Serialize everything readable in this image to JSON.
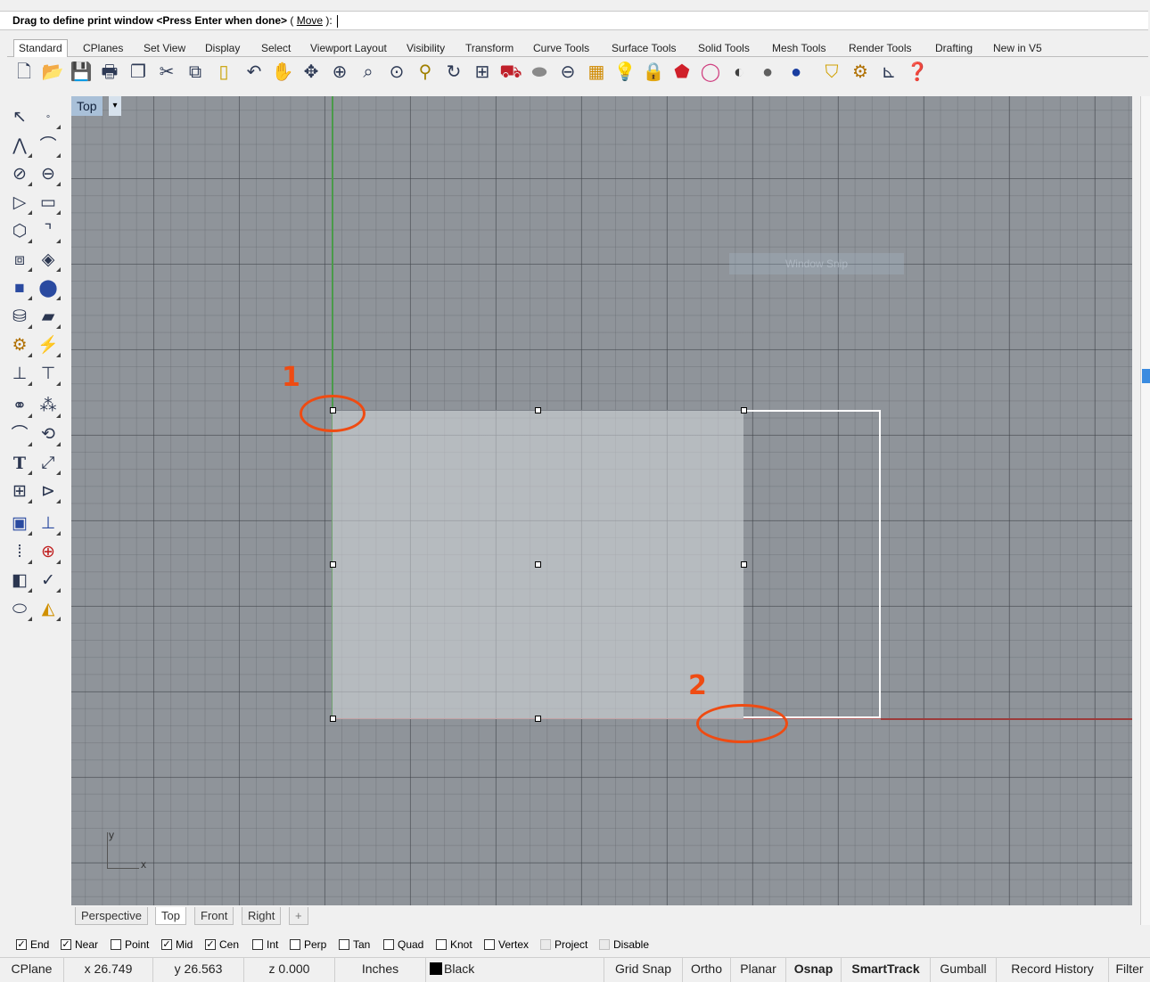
{
  "command": {
    "prompt": "Drag to define print window <Press Enter when done>",
    "option_open": " ( ",
    "option": "Move",
    "option_close": " ): "
  },
  "toolbar_tabs": [
    "Standard",
    "CPlanes",
    "Set View",
    "Display",
    "Select",
    "Viewport Layout",
    "Visibility",
    "Transform",
    "Curve Tools",
    "Surface Tools",
    "Solid Tools",
    "Mesh Tools",
    "Render Tools",
    "Drafting",
    "New in V5"
  ],
  "toolbar_icons": [
    "new-icon",
    "open-icon",
    "save-icon",
    "print-icon",
    "import-icon",
    "cut-icon",
    "copy-icon",
    "paste-icon",
    "undo-icon",
    "pan-icon",
    "rotate-view-icon",
    "zoom-icon",
    "zoom-window-icon",
    "zoom-extents-icon",
    "zoom-selected-icon",
    "rotate-icon",
    "four-viewports-icon",
    "car-icon",
    "camera-icon",
    "target-icon",
    "named-views-icon",
    "light-icon",
    "lock-icon",
    "render-icon",
    "color-icon",
    "shade-icon",
    "rendered-icon",
    "sphere-icon",
    "layer-icon",
    "options-icon",
    "dimension-icon",
    "help-icon"
  ],
  "viewport": {
    "name": "Top",
    "ghost_label": "Window Snip",
    "axis_y": "y",
    "axis_x": "x",
    "marker1": "1",
    "marker2": "2"
  },
  "viewport_tabs": [
    "Perspective",
    "Top",
    "Front",
    "Right",
    "+"
  ],
  "osnaps": [
    {
      "label": "End",
      "checked": true
    },
    {
      "label": "Near",
      "checked": true
    },
    {
      "label": "Point",
      "checked": false
    },
    {
      "label": "Mid",
      "checked": true
    },
    {
      "label": "Cen",
      "checked": true
    },
    {
      "label": "Int",
      "checked": false
    },
    {
      "label": "Perp",
      "checked": false
    },
    {
      "label": "Tan",
      "checked": false
    },
    {
      "label": "Quad",
      "checked": false
    },
    {
      "label": "Knot",
      "checked": false
    },
    {
      "label": "Vertex",
      "checked": false
    },
    {
      "label": "Project",
      "checked": false,
      "disabled": true
    },
    {
      "label": "Disable",
      "checked": false,
      "disabled": true
    }
  ],
  "status": {
    "cplane": "CPlane",
    "x": "x 26.749",
    "y": "y 26.563",
    "z": "z 0.000",
    "units": "Inches",
    "layer": "Black",
    "layer_color": "#000000",
    "grid_snap": "Grid Snap",
    "ortho": "Ortho",
    "planar": "Planar",
    "osnap": "Osnap",
    "smarttrack": "SmartTrack",
    "gumball": "Gumball",
    "record_history": "Record History",
    "filter": "Filter"
  },
  "colors": {
    "annotation": "#ef4b12",
    "viewport_bg": "#8f949a",
    "y_axis": "#4a9a4a",
    "x_axis": "#9c3b3b"
  }
}
